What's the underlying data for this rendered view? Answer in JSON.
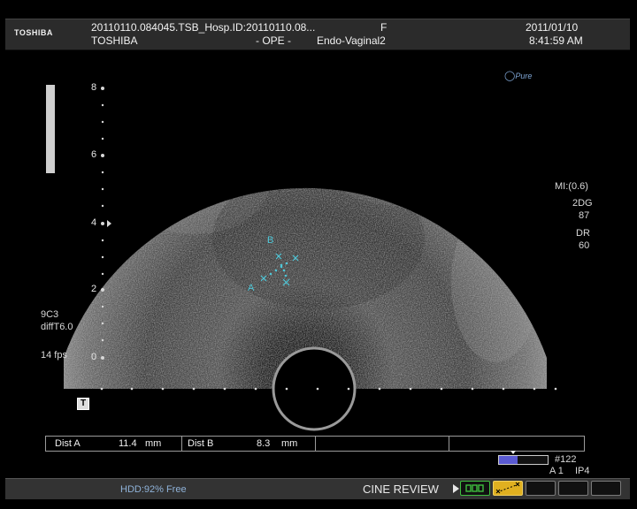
{
  "header": {
    "brand": "TOSHIBA",
    "file_id": "20110110.084045.TSB_Hosp.ID:20110110.08...",
    "sex": "F",
    "date": "2011/01/10",
    "device": "TOSHIBA",
    "operator": "- OPE -",
    "probe_mode": "Endo-Vaginal2",
    "time": "8:41:59 AM",
    "logo_text": "Pure"
  },
  "depth_scale": {
    "labels": [
      "8",
      "6",
      "4",
      "2",
      "0"
    ]
  },
  "right_panel": {
    "mi": "MI:(0.6)",
    "mode": "2DG",
    "gain": "87",
    "dr_label": "DR",
    "dr_value": "60"
  },
  "left_panel": {
    "probe": "9C3",
    "preset": "diffT6.0",
    "frame_rate": "14 fps",
    "marker": "T"
  },
  "calipers": {
    "a_label": "A",
    "b_label": "B"
  },
  "measurements": {
    "dist_a_label": "Dist A",
    "dist_a_value": "11.4",
    "dist_a_unit": "mm",
    "dist_b_label": "Dist B",
    "dist_b_value": "8.3",
    "dist_b_unit": "mm"
  },
  "cine": {
    "frame_number": "#122",
    "a_label": "A 1",
    "ip_label": "IP4",
    "progress": 0.38
  },
  "status_bar": {
    "hdd": "HDD:92% Free",
    "cine_review": "CINE REVIEW"
  },
  "colors": {
    "caliper": "#4fc7d8",
    "cine_bar": "#5a5ad2",
    "active_button": "#e0b020",
    "green_button": "#3fbf3f"
  }
}
